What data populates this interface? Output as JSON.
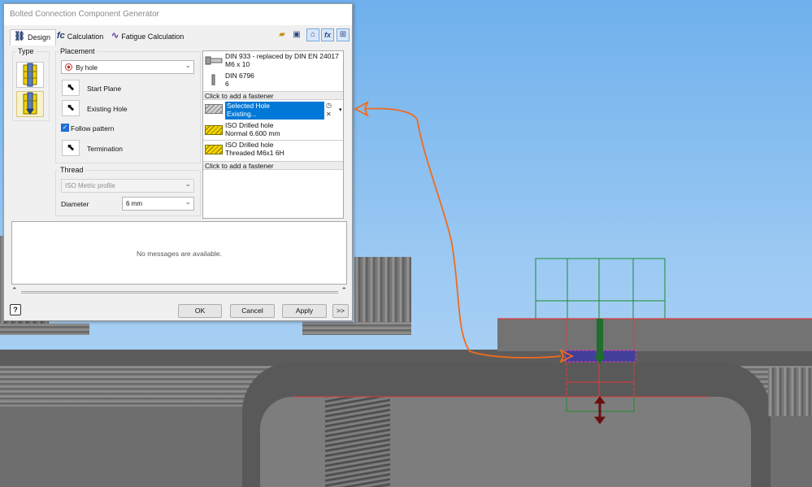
{
  "dialog": {
    "title": "Bolted Connection Component Generator",
    "tabs": [
      {
        "label": "Design",
        "icon": "design-tab-icon",
        "active": true
      },
      {
        "label": "Calculation",
        "icon": "fx-calc-icon",
        "active": false
      },
      {
        "label": "Fatigue Calculation",
        "icon": "fatigue-wave-icon",
        "active": false
      }
    ],
    "toolbar": [
      {
        "name": "open-folder-icon",
        "glyph": "📂"
      },
      {
        "name": "save-icon",
        "glyph": "💾"
      },
      {
        "name": "design-guide-icon",
        "glyph": "⌂"
      },
      {
        "name": "fx-icon",
        "glyph": "fx"
      },
      {
        "name": "options-icon",
        "glyph": "⊞"
      }
    ]
  },
  "type_group": {
    "label": "Type"
  },
  "placement": {
    "label": "Placement",
    "selected": "By hole",
    "start_plane": "Start Plane",
    "existing_hole": "Existing Hole",
    "follow_pattern": "Follow pattern",
    "follow_pattern_checked": true,
    "termination": "Termination"
  },
  "thread": {
    "label": "Thread",
    "profile": "ISO Metric profile",
    "diameter_label": "Diameter",
    "diameter_value": "6 mm"
  },
  "fasteners": {
    "top": [
      {
        "line1": "DIN 933 - replaced by DIN EN 24017",
        "line2": "M6  x 10",
        "icon": "bolt-icon"
      },
      {
        "line1": "DIN 6796",
        "line2": "6",
        "icon": "washer-icon"
      }
    ],
    "add_label_1": "Click to add a fastener",
    "holes": [
      {
        "line1": "Selected Hole",
        "line2": "Existing...",
        "icon": "selected-hole-icon",
        "selected": true
      },
      {
        "line1": "ISO Drilled hole",
        "line2": "Normal 6.600 mm",
        "icon": "drilled-hole-icon",
        "selected": false
      },
      {
        "line1": "ISO Drilled hole",
        "line2": "Threaded M6x1 6H",
        "icon": "threaded-hole-icon",
        "selected": false
      }
    ],
    "add_label_2": "Click to add a fastener"
  },
  "messages": {
    "text": "No messages are available."
  },
  "buttons": {
    "ok": "OK",
    "cancel": "Cancel",
    "apply": "Apply",
    "more": ">>",
    "help": "?"
  },
  "colors": {
    "selection": "#0078d7",
    "annotation_arrow": "#f06b1c",
    "wire_green": "#1f8a2e",
    "wire_red": "#e23a3a",
    "hole_highlight": "#3d3aa6"
  }
}
